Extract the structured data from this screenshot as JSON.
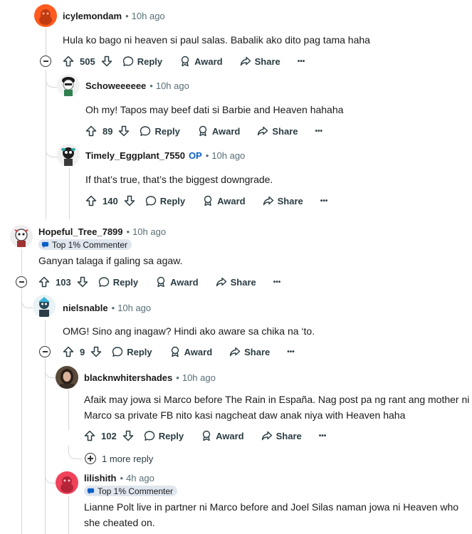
{
  "labels": {
    "reply": "Reply",
    "award": "Award",
    "share": "Share",
    "more": "•••"
  },
  "comments": [
    {
      "user": "icylemondam",
      "time": "10h ago",
      "text": "Hula ko bago ni heaven si paul salas. Babalik ako dito pag tama haha",
      "votes": "505"
    },
    {
      "user": "Schoweeeeee",
      "time": "10h ago",
      "text": "Oh my! Tapos may beef dati si Barbie and Heaven hahaha",
      "votes": "89"
    },
    {
      "user": "Timely_Eggplant_7550",
      "op": "OP",
      "time": "10h ago",
      "text": "If that’s true, that’s the biggest downgrade.",
      "votes": "140"
    },
    {
      "user": "Hopeful_Tree_7899",
      "time": "10h ago",
      "badge": "Top 1% Commenter",
      "text": "Ganyan talaga if galing sa agaw.",
      "votes": "103"
    },
    {
      "user": "nielsnable",
      "time": "10h ago",
      "text": "OMG! Sino ang inagaw? Hindi ako aware sa chika na ‘to.",
      "votes": "9"
    },
    {
      "user": "blacknwhitershades",
      "time": "10h ago",
      "text1": "Afaik may jowa si Marco before The Rain in España. Nag post pa ng rant ang mother ni",
      "text2": "Marco sa private FB nito kasi nagcheat daw anak niya with Heaven haha",
      "votes": "102",
      "more_replies": "1 more reply"
    },
    {
      "user": "lilishith",
      "time": "4h ago",
      "badge": "Top 1% Commenter",
      "text1": "Lianne Polt live in partner ni Marco before and Joel Silas naman jowa ni Heaven who",
      "text2": "she cheated on."
    }
  ]
}
